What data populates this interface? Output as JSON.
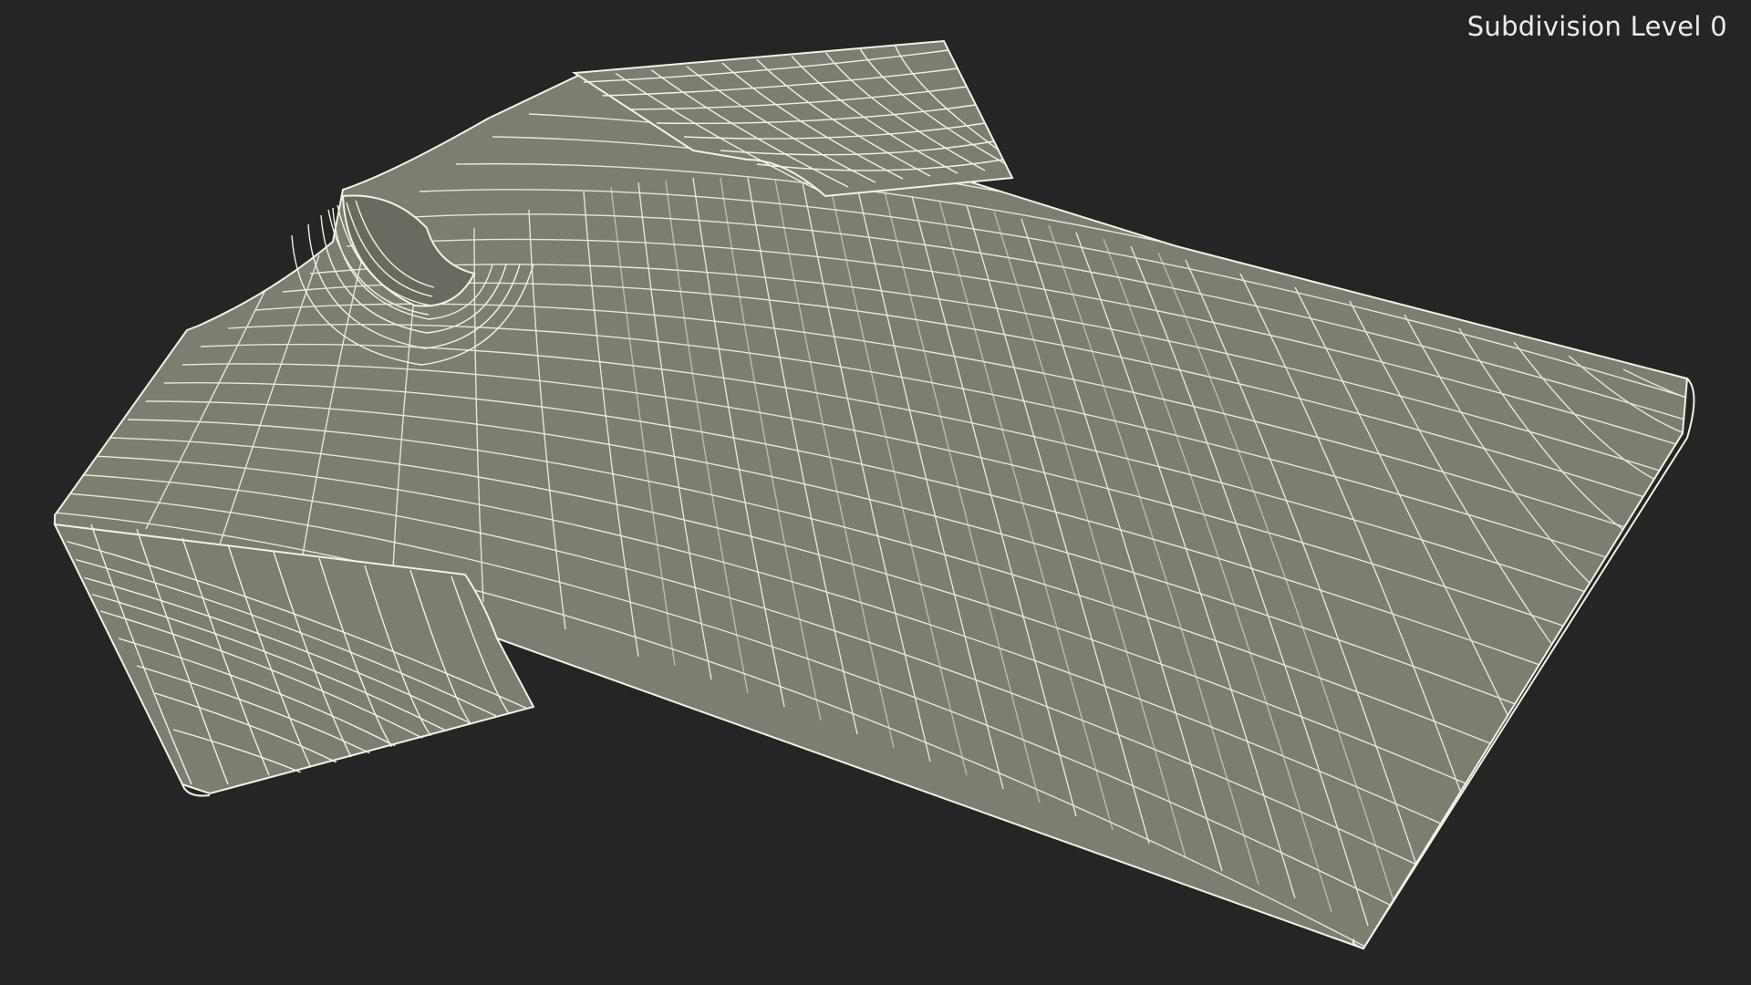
{
  "viewport": {
    "background_color": "#252525",
    "label": "Subdivision Level 0"
  },
  "model": {
    "subject": "t-shirt-wireframe-icon",
    "fill_color": "#7d7d72",
    "shade_color": "#6a6a60",
    "wire_color": "#f4f1e4"
  }
}
